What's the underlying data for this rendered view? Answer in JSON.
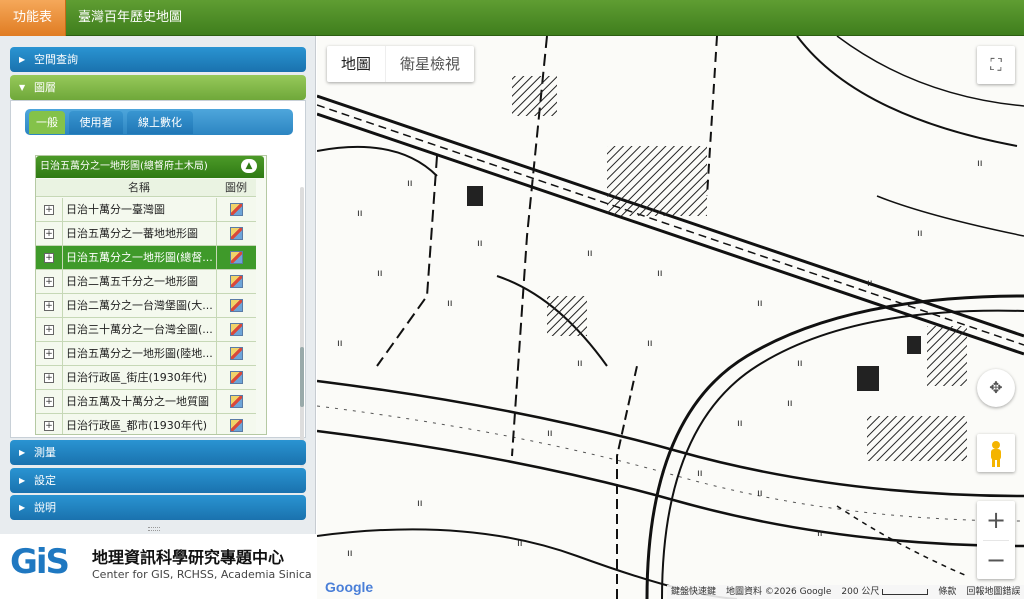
{
  "topbar": {
    "menu_label": "功能表",
    "title": "臺灣百年歷史地圖"
  },
  "sidebar": {
    "sections": {
      "spatial_query": "空間查詢",
      "layers": "圖層",
      "measure": "測量",
      "settings": "設定",
      "help": "說明"
    },
    "tabs": [
      "一般",
      "使用者",
      "線上數化"
    ],
    "layer_table": {
      "caption": "日治五萬分之一地形圖(總督府土木局)",
      "col_name": "名稱",
      "col_legend": "圖例",
      "rows": [
        "日治十萬分一臺灣圖",
        "日治五萬分之一蕃地地形圖",
        "日治五萬分之一地形圖(總督...",
        "日治二萬五千分之一地形圖",
        "日治二萬分之一台灣堡圖(大...",
        "日治三十萬分之一台灣全圖(...",
        "日治五萬分之一地形圖(陸地...",
        "日治行政區_街庄(1930年代)",
        "日治五萬及十萬分之一地質圖",
        "日治行政區_都市(1930年代)"
      ],
      "selected_index": 2
    },
    "logo": {
      "gis_text": "GiS",
      "cn": "地理資訊科學研究專題中心",
      "en": "Center for GIS, RCHSS, Academia Sinica"
    }
  },
  "map": {
    "type_buttons": {
      "map": "地圖",
      "satellite": "衛星檢視"
    },
    "zoom_in": "+",
    "zoom_out": "−",
    "fullscreen_icon": "fullscreen-icon",
    "google_logo": "Google",
    "attribution": {
      "shortcuts": "鍵盤快速鍵",
      "data": "地圖資料 ©2026 Google",
      "scale": "200 公尺",
      "terms": "條款",
      "report": "回報地圖錯誤"
    }
  }
}
